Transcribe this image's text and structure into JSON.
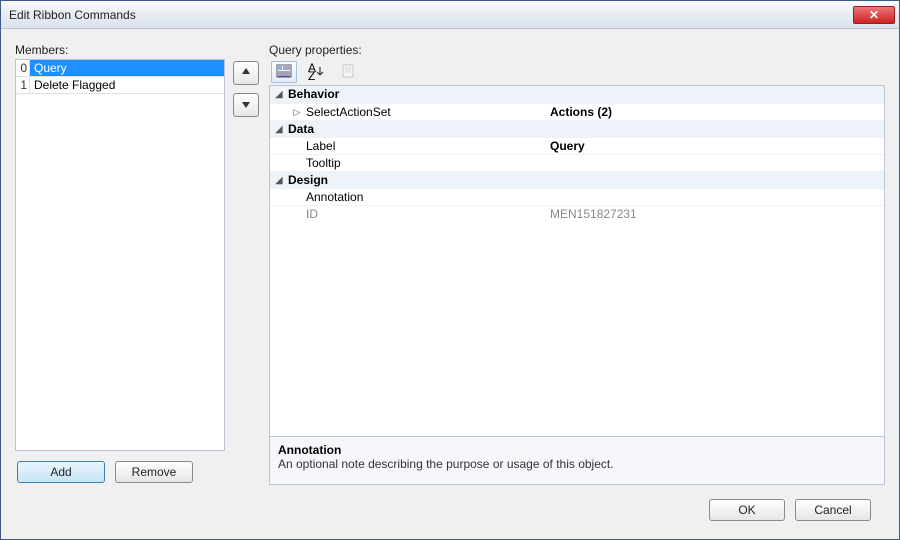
{
  "window": {
    "title": "Edit Ribbon Commands"
  },
  "members": {
    "label": "Members:",
    "items": [
      {
        "index": "0",
        "text": "Query",
        "selected": true
      },
      {
        "index": "1",
        "text": "Delete Flagged",
        "selected": false
      }
    ],
    "add": "Add",
    "remove": "Remove"
  },
  "query_properties": {
    "label": "Query properties:"
  },
  "grid": {
    "behavior_label": "Behavior",
    "select_action_set_label": "SelectActionSet",
    "select_action_set_value": "Actions (2)",
    "data_label": "Data",
    "label_label": "Label",
    "label_value": "Query",
    "tooltip_label": "Tooltip",
    "tooltip_value": "",
    "design_label": "Design",
    "annotation_label": "Annotation",
    "annotation_value": "",
    "id_label": "ID",
    "id_value": "MEN151827231"
  },
  "description": {
    "title": "Annotation",
    "text": "An optional note describing the purpose or usage of this object."
  },
  "footer": {
    "ok": "OK",
    "cancel": "Cancel"
  }
}
